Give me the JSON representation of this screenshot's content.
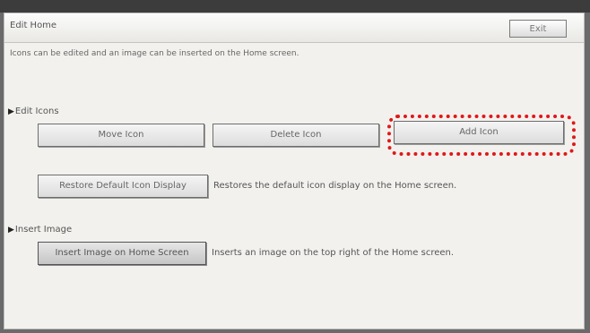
{
  "window": {
    "title": "Edit Home",
    "exit_label": "Exit"
  },
  "description": "Icons can be edited and an image can be inserted on the Home screen.",
  "edit_icons": {
    "heading": "Edit Icons",
    "move_label": "Move Icon",
    "delete_label": "Delete Icon",
    "add_label": "Add Icon",
    "restore_label": "Restore Default Icon Display",
    "restore_note": "Restores the default icon display on the Home screen."
  },
  "insert_image": {
    "heading": "Insert Image",
    "insert_label": "Insert Image on Home Screen",
    "insert_note": "Inserts an image on the top right of the Home screen."
  },
  "colors": {
    "highlight": "#e01818"
  }
}
